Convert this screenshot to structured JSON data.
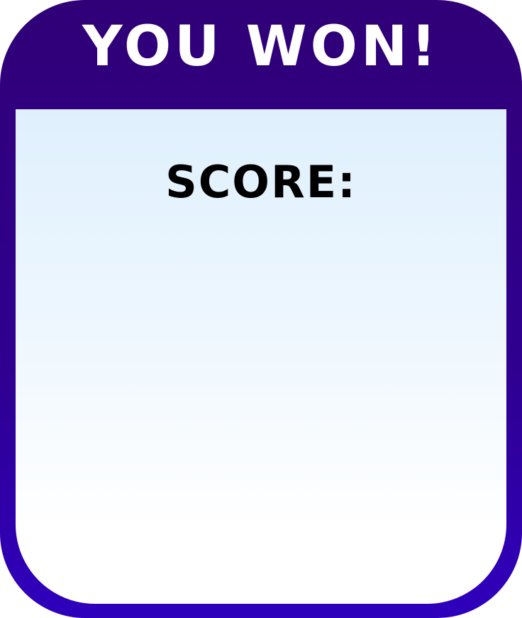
{
  "dialog": {
    "title": "YOU WON!",
    "score_label": "SCORE:",
    "score_value": ""
  },
  "colors": {
    "frame_top": "#300077",
    "frame_bottom": "#2f00bd",
    "panel_top": "#dff0fd",
    "panel_bottom": "#ffffff",
    "title_text": "#ffffff",
    "score_text": "#000000"
  }
}
